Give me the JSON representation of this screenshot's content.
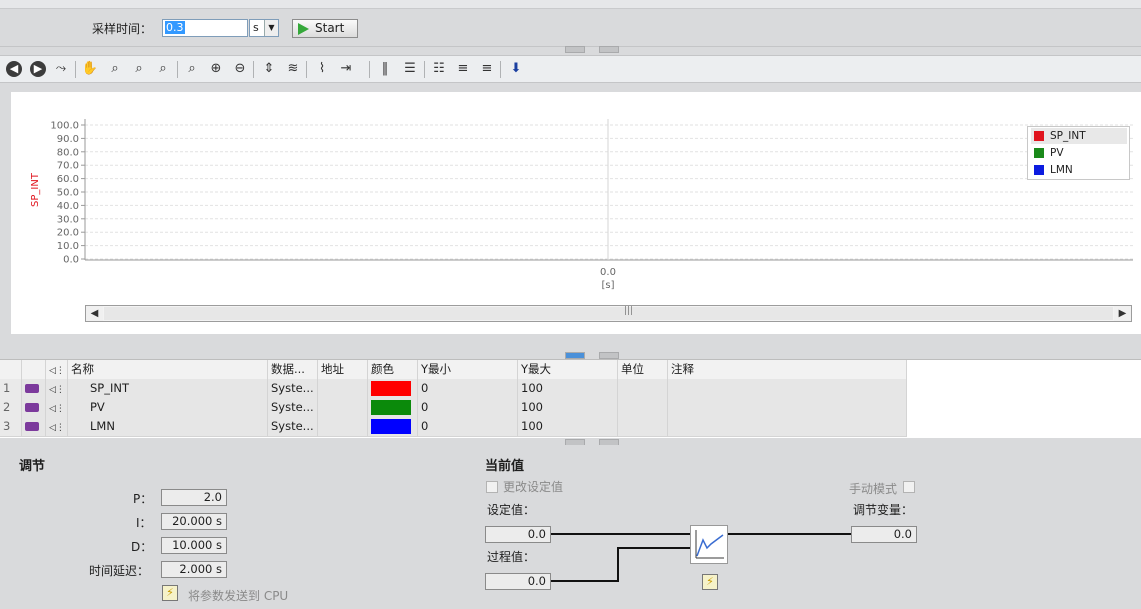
{
  "sampling": {
    "label": "采样时间：",
    "value": "0.3",
    "unit": "s",
    "start_label": "Start"
  },
  "toolbar": {
    "icons": [
      "back-icon",
      "forward-icon",
      "curve-overview-icon",
      "pan-icon",
      "zoom-rect-icon",
      "zoom-x-icon",
      "zoom-y-icon",
      "zoom-100-icon",
      "zoom-in-icon",
      "zoom-out-icon",
      "fit-y-icon",
      "fit-all-icon",
      "measure-icon",
      "time-axis-icon",
      "ruler-1-icon",
      "ruler-2-icon",
      "legend-icon",
      "align-left-icon",
      "align-right-icon",
      "export-icon"
    ]
  },
  "chart_data": {
    "type": "line",
    "ylabel": "SP_INT",
    "ylabel_color": "#e0141e",
    "y_ticks": [
      "100.0",
      "90.0",
      "80.0",
      "70.0",
      "60.0",
      "50.0",
      "40.0",
      "30.0",
      "20.0",
      "10.0",
      "0.0"
    ],
    "ylim": [
      0,
      100
    ],
    "x_ticks": [
      "0.0"
    ],
    "xlabel": "[s]",
    "grid": true,
    "legend_position": "top-right",
    "series": [
      {
        "name": "SP_INT",
        "color": "#e0141e",
        "values": []
      },
      {
        "name": "PV",
        "color": "#1a8a1a",
        "values": []
      },
      {
        "name": "LMN",
        "color": "#0c1ce0",
        "values": []
      }
    ]
  },
  "table": {
    "headers": [
      "名称",
      "数据...",
      "地址",
      "颜色",
      "Y最小",
      "Y最大",
      "单位",
      "注释"
    ],
    "rows": [
      {
        "num": "1",
        "name": "SP_INT",
        "data": "Syste...",
        "address": "",
        "color": "#ff0000",
        "ymin": "0",
        "ymax": "100",
        "unit": "",
        "comment": ""
      },
      {
        "num": "2",
        "name": "PV",
        "data": "Syste...",
        "address": "",
        "color": "#0b8a0b",
        "ymin": "0",
        "ymax": "100",
        "unit": "",
        "comment": ""
      },
      {
        "num": "3",
        "name": "LMN",
        "data": "Syste...",
        "address": "",
        "color": "#0000ff",
        "ymin": "0",
        "ymax": "100",
        "unit": "",
        "comment": ""
      }
    ]
  },
  "tuning": {
    "title": "调节",
    "p_label": "P：",
    "p_value": "2.0",
    "i_label": "I：",
    "i_value": "20.000 s",
    "d_label": "D：",
    "d_value": "10.000 s",
    "delay_label": "时间延迟：",
    "delay_value": "2.000 s",
    "send_label": "将参数发送到 CPU"
  },
  "current": {
    "title": "当前值",
    "change_setpoint_label": "更改设定值",
    "setpoint_label": "设定值：",
    "setpoint_value": "0.0",
    "process_label": "过程值：",
    "process_value": "0.0",
    "manual_label": "手动模式",
    "output_label": "调节变量：",
    "output_value": "0.0"
  }
}
